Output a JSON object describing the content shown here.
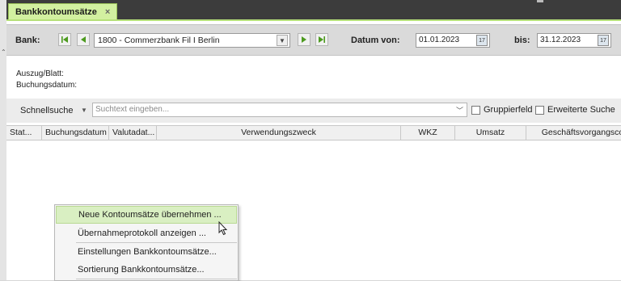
{
  "tab": {
    "title": "Bankkontoumsätze",
    "close": "×"
  },
  "bankbar": {
    "bank_label": "Bank:",
    "bank_value": "1800 - Commerzbank Fil I Berlin",
    "date_from_label": "Datum von:",
    "date_from_value": "01.01.2023",
    "date_to_label": "bis:",
    "date_to_value": "31.12.2023"
  },
  "info": {
    "auszug_label": "Auszug/Blatt:",
    "buchung_label": "Buchungsdatum:"
  },
  "search": {
    "label": "Schnellsuche",
    "placeholder": "Suchtext eingeben...",
    "gruppierfeld_label": "Gruppierfeld",
    "erweitert_label": "Erweiterte Suche"
  },
  "columns": [
    "Stat...",
    "Buchungsdatum",
    "Valutadat...",
    "Verwendungszweck",
    "WKZ",
    "Umsatz",
    "Geschäftsvorgangsco"
  ],
  "context_menu": {
    "items": [
      "Neue Kontoumsätze übernehmen ...",
      "Übernahmeprotokoll anzeigen ...",
      "Einstellungen Bankkontoumsätze...",
      "Sortierung Bankkontoumsätze..."
    ],
    "highlighted_index": 0
  },
  "colors": {
    "accent_green": "#b6e07a",
    "tab_bg": "#d2f0a0",
    "highlight": "#d9efc2"
  }
}
